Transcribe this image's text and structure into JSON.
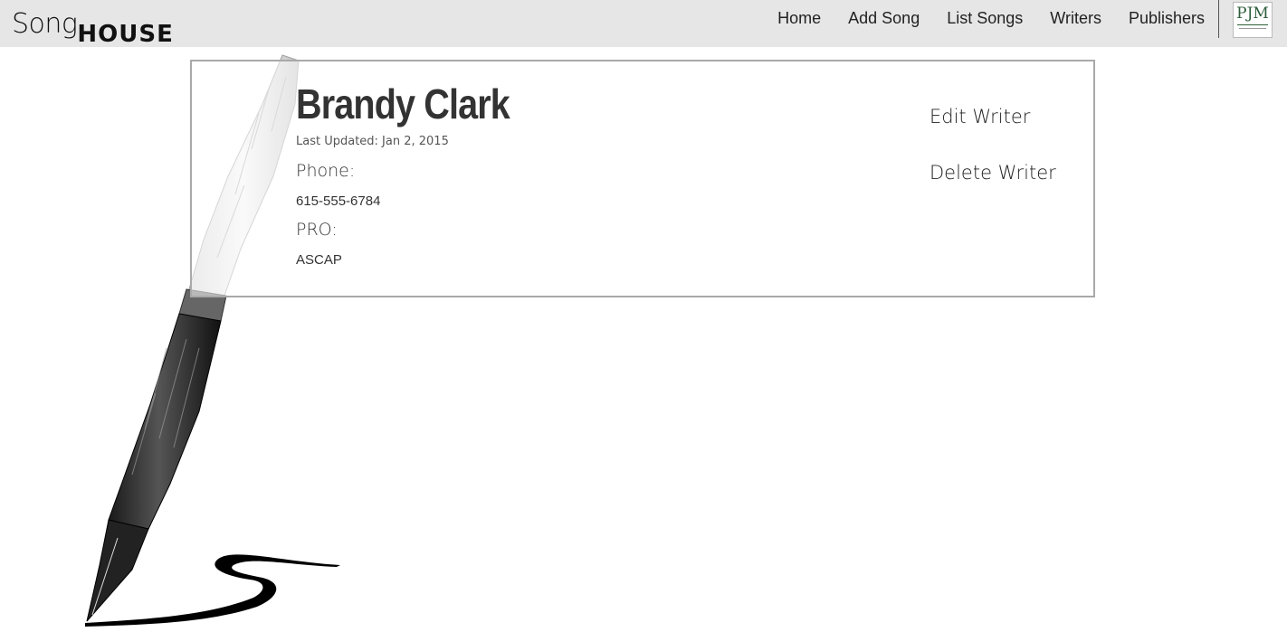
{
  "brand": {
    "song": "Song",
    "house": "House"
  },
  "nav": {
    "items": [
      {
        "label": "Home"
      },
      {
        "label": "Add Song"
      },
      {
        "label": "List Songs"
      },
      {
        "label": "Writers"
      },
      {
        "label": "Publishers"
      }
    ],
    "logo_text": "PJM"
  },
  "writer": {
    "name": "Brandy Clark",
    "last_updated": "Last Updated: Jan 2, 2015",
    "phone_label": "Phone:",
    "phone_value": "615-555-6784",
    "pro_label": "PRO:",
    "pro_value": "ASCAP"
  },
  "actions": {
    "edit_label": "Edit Writer",
    "delete_label": "Delete Writer"
  },
  "colors": {
    "topbar_bg": "#e6e6e6",
    "card_border": "#a9a9a9",
    "logo_green": "#2e5e3b"
  },
  "icons": {
    "background_art": "fountain-pen-illustration"
  }
}
